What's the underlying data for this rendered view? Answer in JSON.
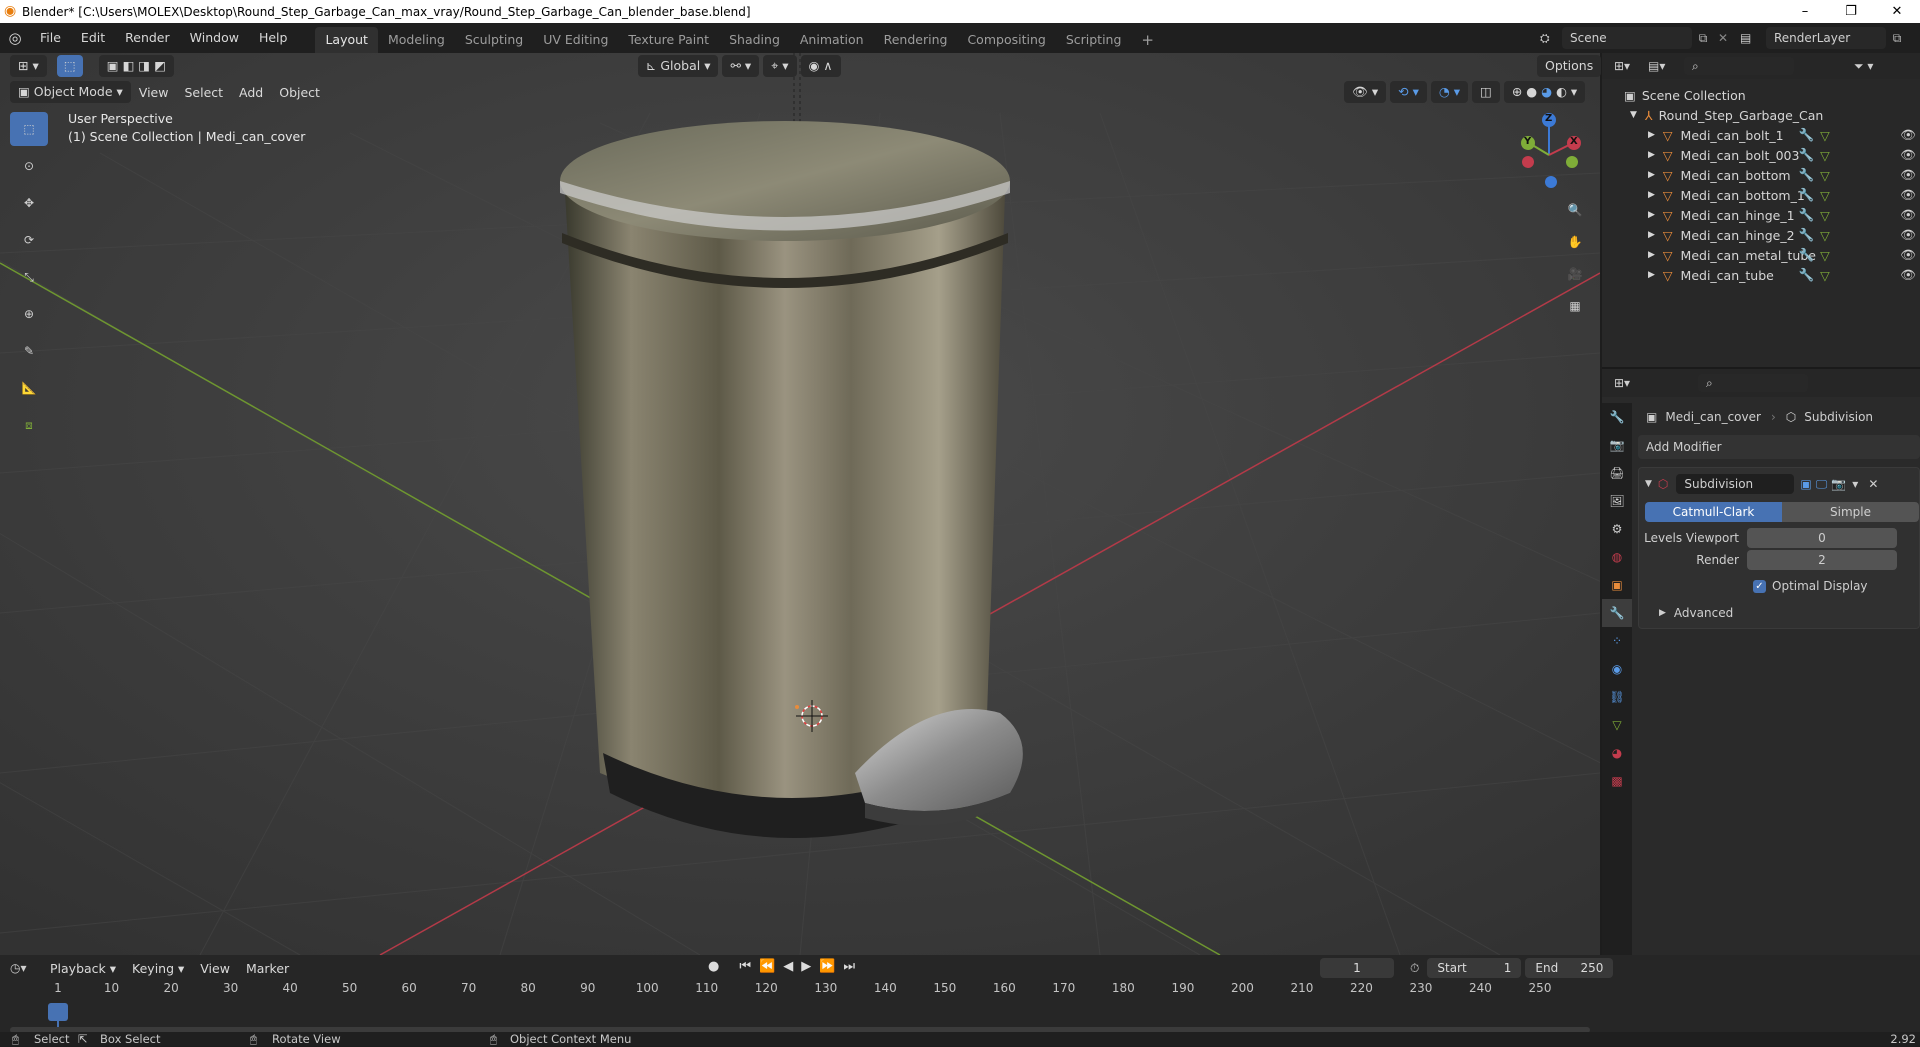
{
  "window": {
    "title": "Blender* [C:\\Users\\MOLEX\\Desktop\\Round_Step_Garbage_Can_max_vray/Round_Step_Garbage_Can_blender_base.blend]",
    "minimize": "–",
    "maximize": "❐",
    "close": "✕"
  },
  "menu": [
    "File",
    "Edit",
    "Render",
    "Window",
    "Help"
  ],
  "workspaces": [
    "Layout",
    "Modeling",
    "Sculpting",
    "UV Editing",
    "Texture Paint",
    "Shading",
    "Animation",
    "Rendering",
    "Compositing",
    "Scripting"
  ],
  "workspace_add": "+",
  "scene": {
    "name": "Scene",
    "render_layer": "RenderLayer"
  },
  "viewport": {
    "transform_orientation": "Global",
    "options": "Options",
    "mode": "Object Mode",
    "menus": [
      "View",
      "Select",
      "Add",
      "Object"
    ],
    "perspective": "User Perspective",
    "collection_info": "(1) Scene Collection | Medi_can_cover",
    "gizmo": {
      "x": "X",
      "y": "Y",
      "z": "Z"
    }
  },
  "outliner": {
    "root": "Scene Collection",
    "collection": "Round_Step_Garbage_Can",
    "objects": [
      "Medi_can_bolt_1",
      "Medi_can_bolt_003",
      "Medi_can_bottom",
      "Medi_can_bottom_1",
      "Medi_can_hinge_1",
      "Medi_can_hinge_2",
      "Medi_can_metal_tube",
      "Medi_can_tube"
    ]
  },
  "properties": {
    "object_name": "Medi_can_cover",
    "modifier_breadcrumb": "Subdivision",
    "add_modifier": "Add Modifier",
    "modifier": {
      "name": "Subdivision",
      "type_options": [
        "Catmull-Clark",
        "Simple"
      ],
      "selected_type": "Catmull-Clark",
      "levels_viewport_label": "Levels Viewport",
      "levels_viewport": "0",
      "render_label": "Render",
      "render": "2",
      "optimal_display_label": "Optimal Display",
      "optimal_display": true,
      "advanced_label": "Advanced"
    }
  },
  "timeline": {
    "menus": [
      "Playback",
      "Keying",
      "View",
      "Marker"
    ],
    "current_frame": "1",
    "start_label": "Start",
    "start": "1",
    "end_label": "End",
    "end": "250",
    "ticks": [
      "1",
      "10",
      "20",
      "30",
      "40",
      "50",
      "60",
      "70",
      "80",
      "90",
      "100",
      "110",
      "120",
      "130",
      "140",
      "150",
      "160",
      "170",
      "180",
      "190",
      "200",
      "210",
      "220",
      "230",
      "240",
      "250"
    ]
  },
  "status": {
    "select": "Select",
    "box_select": "Box Select",
    "rotate_view": "Rotate View",
    "context_menu": "Object Context Menu",
    "version": "2.92"
  },
  "colors": {
    "accent": "#4772b3",
    "x_axis": "#c43c4d",
    "y_axis": "#7fad38",
    "z_axis": "#3c7ad6",
    "orange": "#e98c3b"
  }
}
